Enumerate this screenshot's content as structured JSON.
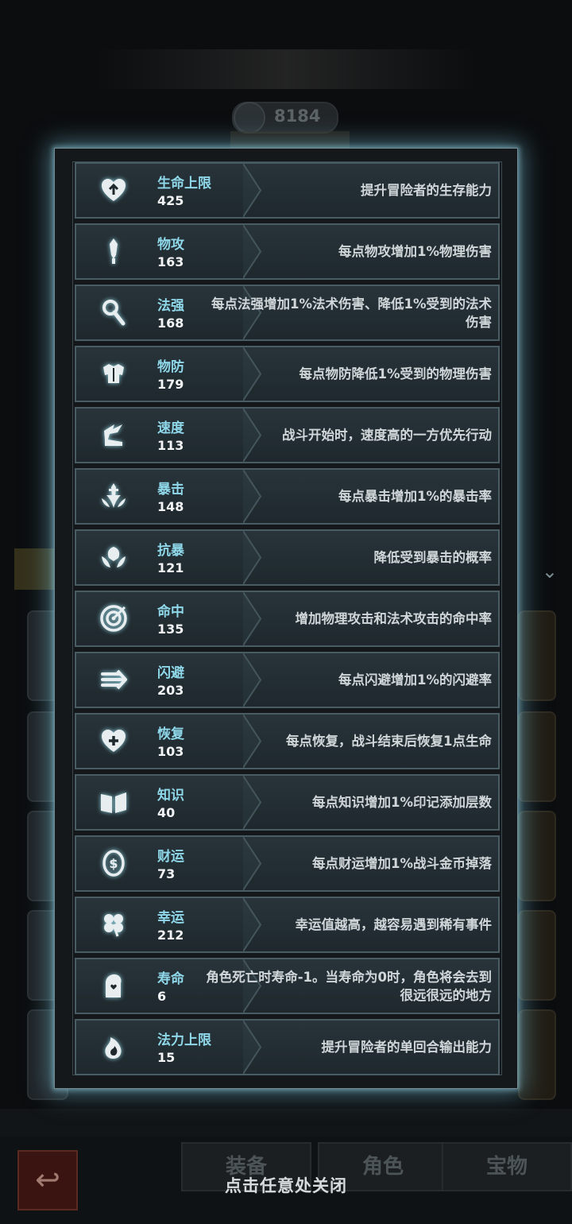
{
  "background": {
    "power_value": "8184",
    "tabs": [
      "装备",
      "角色",
      "宝物"
    ]
  },
  "stats": [
    {
      "icon": "heart-up-icon",
      "name": "生命上限",
      "value": "425",
      "desc": "提升冒险者的生存能力"
    },
    {
      "icon": "sword-icon",
      "name": "物攻",
      "value": "163",
      "desc": "每点物攻增加1%物理伤害"
    },
    {
      "icon": "staff-icon",
      "name": "法强",
      "value": "168",
      "desc": "每点法强增加1%法术伤害、降低1%受到的法术伤害"
    },
    {
      "icon": "armor-icon",
      "name": "物防",
      "value": "179",
      "desc": "每点物防降低1%受到的物理伤害"
    },
    {
      "icon": "winged-boot-icon",
      "name": "速度",
      "value": "113",
      "desc": "战斗开始时，速度高的一方优先行动"
    },
    {
      "icon": "crit-sword-icon",
      "name": "暴击",
      "value": "148",
      "desc": "每点暴击增加1%的暴击率"
    },
    {
      "icon": "crit-shield-icon",
      "name": "抗暴",
      "value": "121",
      "desc": "降低受到暴击的概率"
    },
    {
      "icon": "target-icon",
      "name": "命中",
      "value": "135",
      "desc": "增加物理攻击和法术攻击的命中率"
    },
    {
      "icon": "dodge-arrow-icon",
      "name": "闪避",
      "value": "203",
      "desc": "每点闪避增加1%的闪避率"
    },
    {
      "icon": "heart-plus-icon",
      "name": "恢复",
      "value": "103",
      "desc": "每点恢复，战斗结束后恢复1点生命"
    },
    {
      "icon": "book-icon",
      "name": "知识",
      "value": "40",
      "desc": "每点知识增加1%印记添加层数"
    },
    {
      "icon": "coin-icon",
      "name": "财运",
      "value": "73",
      "desc": "每点财运增加1%战斗金币掉落"
    },
    {
      "icon": "clover-icon",
      "name": "幸运",
      "value": "212",
      "desc": "幸运值越高，越容易遇到稀有事件"
    },
    {
      "icon": "tombstone-icon",
      "name": "寿命",
      "value": "6",
      "desc": "角色死亡时寿命-1。当寿命为0时，角色将会去到很远很远的地方"
    },
    {
      "icon": "mana-flame-icon",
      "name": "法力上限",
      "value": "15",
      "desc": "提升冒险者的单回合输出能力"
    }
  ],
  "close_hint": "点击任意处关闭"
}
